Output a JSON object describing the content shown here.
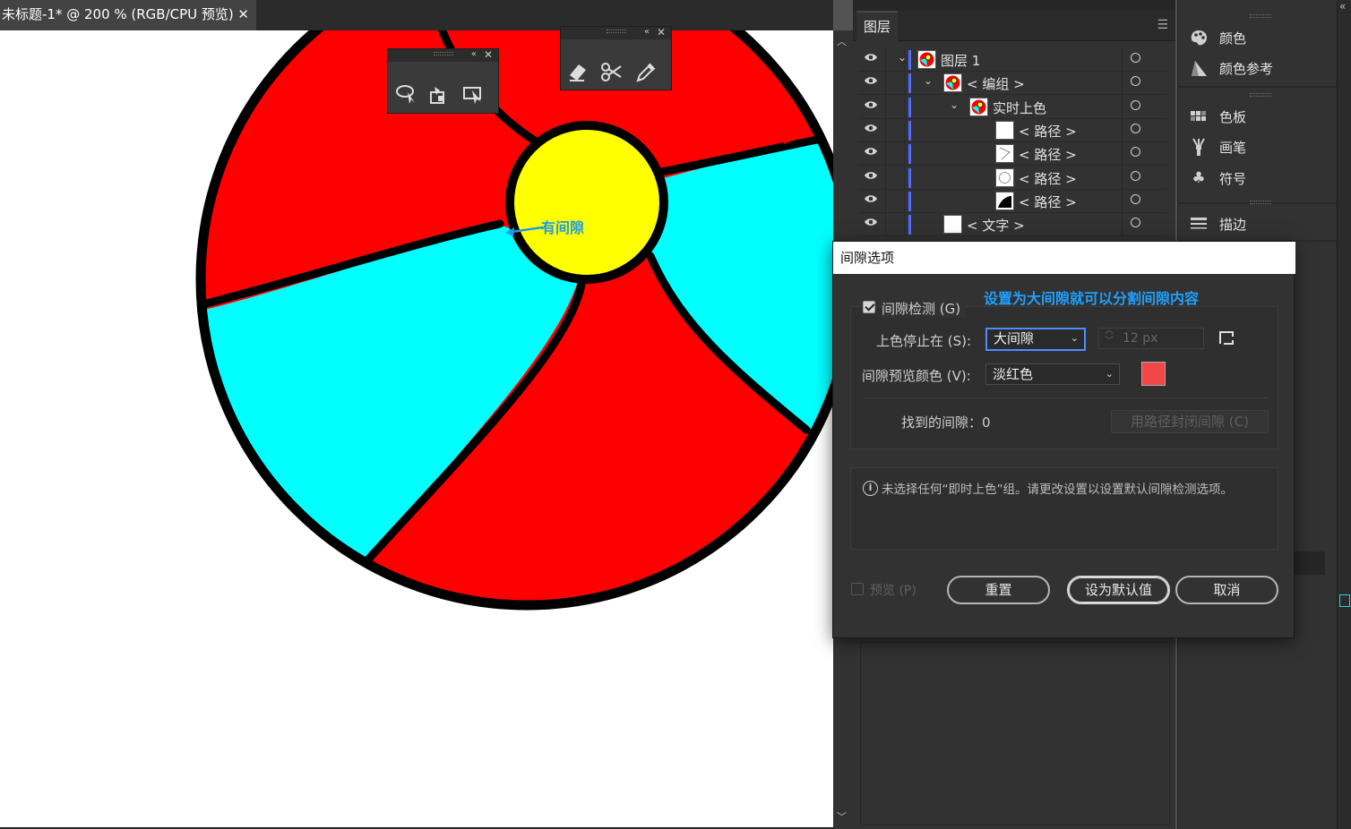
{
  "document": {
    "tab_title": "未标题-1* @ 200 % (RGB/CPU 预览)",
    "close_glyph": "✕"
  },
  "canvas": {
    "annotation": "有间隙",
    "colors": {
      "red": "#ff0000",
      "cyan": "#00ffff",
      "yellow": "#ffff00",
      "stroke": "#000000",
      "annotation": "#1e9be8"
    }
  },
  "float_panels": {
    "panel_a": {
      "collapse": "«",
      "close": "✕",
      "tools": [
        "lasso-select-icon",
        "live-paint-icon",
        "live-paint-select-icon"
      ]
    },
    "panel_b": {
      "collapse": "«",
      "close": "✕",
      "tools": [
        "eraser-icon",
        "scissors-icon",
        "eyedropper-icon"
      ]
    }
  },
  "layers_panel": {
    "tab": "图层",
    "menu": "☰",
    "rows": [
      {
        "name": "图层 1",
        "indent": 0,
        "expanded": true
      },
      {
        "name": "< 编组 >",
        "indent": 1,
        "expanded": true
      },
      {
        "name": "实时上色",
        "indent": 2,
        "expanded": true
      },
      {
        "name": "< 路径 >",
        "indent": 3
      },
      {
        "name": "< 路径 >",
        "indent": 3
      },
      {
        "name": "< 路径 >",
        "indent": 3
      },
      {
        "name": "< 路径 >",
        "indent": 3
      },
      {
        "name": "< 文字 >",
        "indent": 1
      }
    ]
  },
  "right_dock": {
    "items": [
      {
        "label": "颜色",
        "icon": "color-palette-icon"
      },
      {
        "label": "颜色参考",
        "icon": "color-guide-icon"
      },
      {
        "label": "色板",
        "icon": "swatches-icon"
      },
      {
        "label": "画笔",
        "icon": "brush-icon"
      },
      {
        "label": "符号",
        "icon": "symbol-club-icon"
      },
      {
        "label": "描边",
        "icon": "stroke-lines-icon"
      }
    ]
  },
  "dialog": {
    "title": "间隙选项",
    "annotation": "设置为大间隙就可以分割间隙内容",
    "gap_detection_label": "间隙检测 (G)",
    "gap_detection_checked": true,
    "stop_at_label": "上色停止在 (S):",
    "stop_at_value": "大间隙",
    "px_value": "12 px",
    "preview_color_label": "间隙预览颜色 (V):",
    "preview_color_value": "淡红色",
    "preview_swatch_color": "#f04848",
    "found_gaps_label": "找到的间隙：0",
    "close_gaps_button": "用路径封闭间隙 (C)",
    "info_text": "未选择任何“即时上色”组。请更改设置以设置默认间隙检测选项。",
    "preview_label": "预览 (P)",
    "preview_checked": false,
    "reset_button": "重置",
    "set_default_button": "设为默认值",
    "cancel_button": "取消"
  }
}
